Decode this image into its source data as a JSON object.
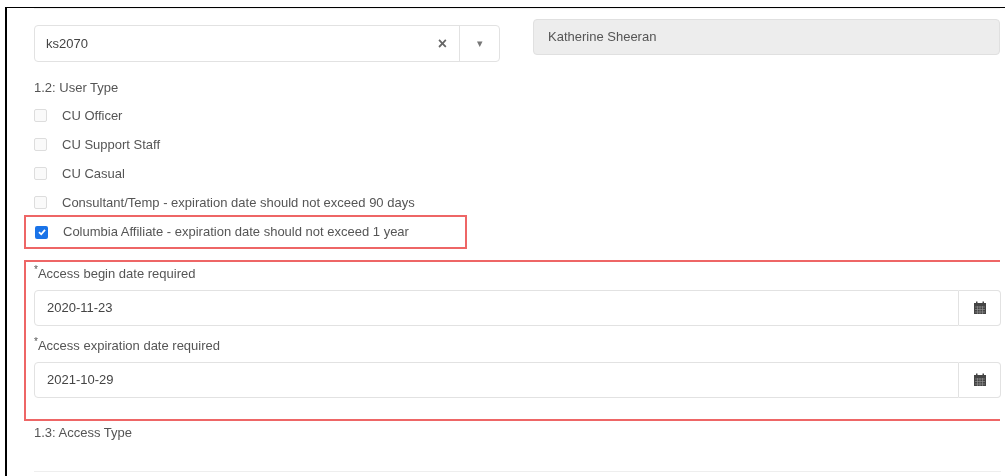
{
  "user_select": {
    "value": "ks2070",
    "clear": "×",
    "caret": "▾"
  },
  "user_name": {
    "value": "Katherine Sheeran"
  },
  "user_type": {
    "label": "1.2: User Type",
    "options": [
      {
        "label": "CU Officer",
        "checked": false,
        "highlighted": false
      },
      {
        "label": "CU Support Staff",
        "checked": false,
        "highlighted": false
      },
      {
        "label": "CU Casual",
        "checked": false,
        "highlighted": false
      },
      {
        "label": "Consultant/Temp - expiration date should not exceed 90 days",
        "checked": false,
        "highlighted": false
      },
      {
        "label": "Columbia Affiliate - expiration date should not exceed 1 year",
        "checked": true,
        "highlighted": true
      }
    ]
  },
  "dates": {
    "highlighted": true,
    "fields": [
      {
        "required_mark": "*",
        "label": "Access begin date required",
        "value": "2020-11-23"
      },
      {
        "required_mark": "*",
        "label": "Access expiration date required",
        "value": "2021-10-29"
      }
    ]
  },
  "access_type": {
    "label": "1.3: Access Type"
  }
}
